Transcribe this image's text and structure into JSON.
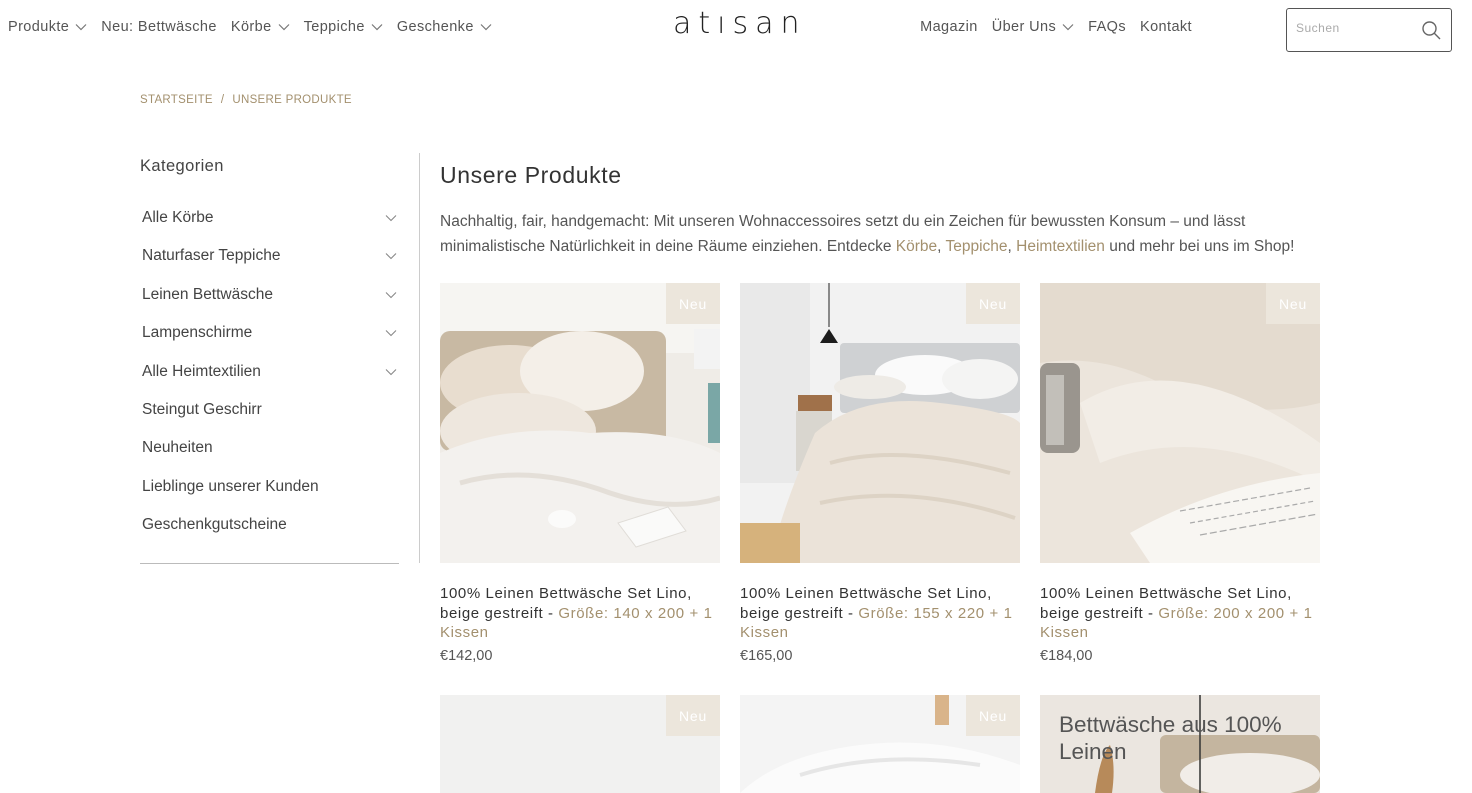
{
  "header": {
    "nav_left": [
      {
        "label": "Produkte",
        "dropdown": true
      },
      {
        "label": "Neu: Bettwäsche",
        "dropdown": false
      },
      {
        "label": "Körbe",
        "dropdown": true
      },
      {
        "label": "Teppiche",
        "dropdown": true
      },
      {
        "label": "Geschenke",
        "dropdown": true
      }
    ],
    "logo": "atısan",
    "nav_right": [
      {
        "label": "Magazin",
        "dropdown": false
      },
      {
        "label": "Über Uns",
        "dropdown": true
      },
      {
        "label": "FAQs",
        "dropdown": false
      },
      {
        "label": "Kontakt",
        "dropdown": false
      }
    ],
    "search_placeholder": "Suchen",
    "search_icon": "search-icon"
  },
  "breadcrumb": {
    "home": "Startseite",
    "separator": "/",
    "current": "Unsere Produkte"
  },
  "sidebar": {
    "title": "Kategorien",
    "items": [
      {
        "label": "Alle Körbe",
        "expandable": true
      },
      {
        "label": "Naturfaser Teppiche",
        "expandable": true
      },
      {
        "label": "Leinen Bettwäsche",
        "expandable": true
      },
      {
        "label": "Lampenschirme",
        "expandable": true
      },
      {
        "label": "Alle Heimtextilien",
        "expandable": true
      },
      {
        "label": "Steingut Geschirr",
        "expandable": false
      },
      {
        "label": "Neuheiten",
        "expandable": false
      },
      {
        "label": "Lieblinge unserer Kunden",
        "expandable": false
      },
      {
        "label": "Geschenkgutscheine",
        "expandable": false
      }
    ]
  },
  "main": {
    "title": "Unsere Produkte",
    "intro_part1": "Nachhaltig, fair, handgemacht: Mit unseren Wohnaccessoires setzt du ein Zeichen für bewussten Konsum – und lässt minimalistische Natürlichkeit in deine Räume einziehen. Entdecke ",
    "intro_link1": "Körbe",
    "intro_comma1": ", ",
    "intro_link2": "Teppiche",
    "intro_comma2": ", ",
    "intro_link3": "Heimtextilien",
    "intro_part2": " und mehr bei uns im Shop!",
    "products": [
      {
        "badge": "Neu",
        "title": "100% Leinen Bettwäsche Set Lino, beige gestreift",
        "dash": " - ",
        "variant": "Größe: 140 x 200 + 1 Kissen",
        "price": "€142,00"
      },
      {
        "badge": "Neu",
        "title": "100% Leinen Bettwäsche Set Lino, beige gestreift",
        "dash": " - ",
        "variant": "Größe: 155 x 220 + 1 Kissen",
        "price": "€165,00"
      },
      {
        "badge": "Neu",
        "title": "100% Leinen Bettwäsche Set Lino, beige gestreift",
        "dash": " - ",
        "variant": "Größe: 200 x 200 + 1 Kissen",
        "price": "€184,00"
      }
    ],
    "row2": [
      {
        "badge": "Neu"
      },
      {
        "badge": "Neu"
      },
      {
        "promo": "Bettwäsche aus 100% Leinen"
      }
    ]
  },
  "colors": {
    "accent": "#a3906e",
    "badge_bg": "#ece6dc",
    "text": "#333333"
  }
}
